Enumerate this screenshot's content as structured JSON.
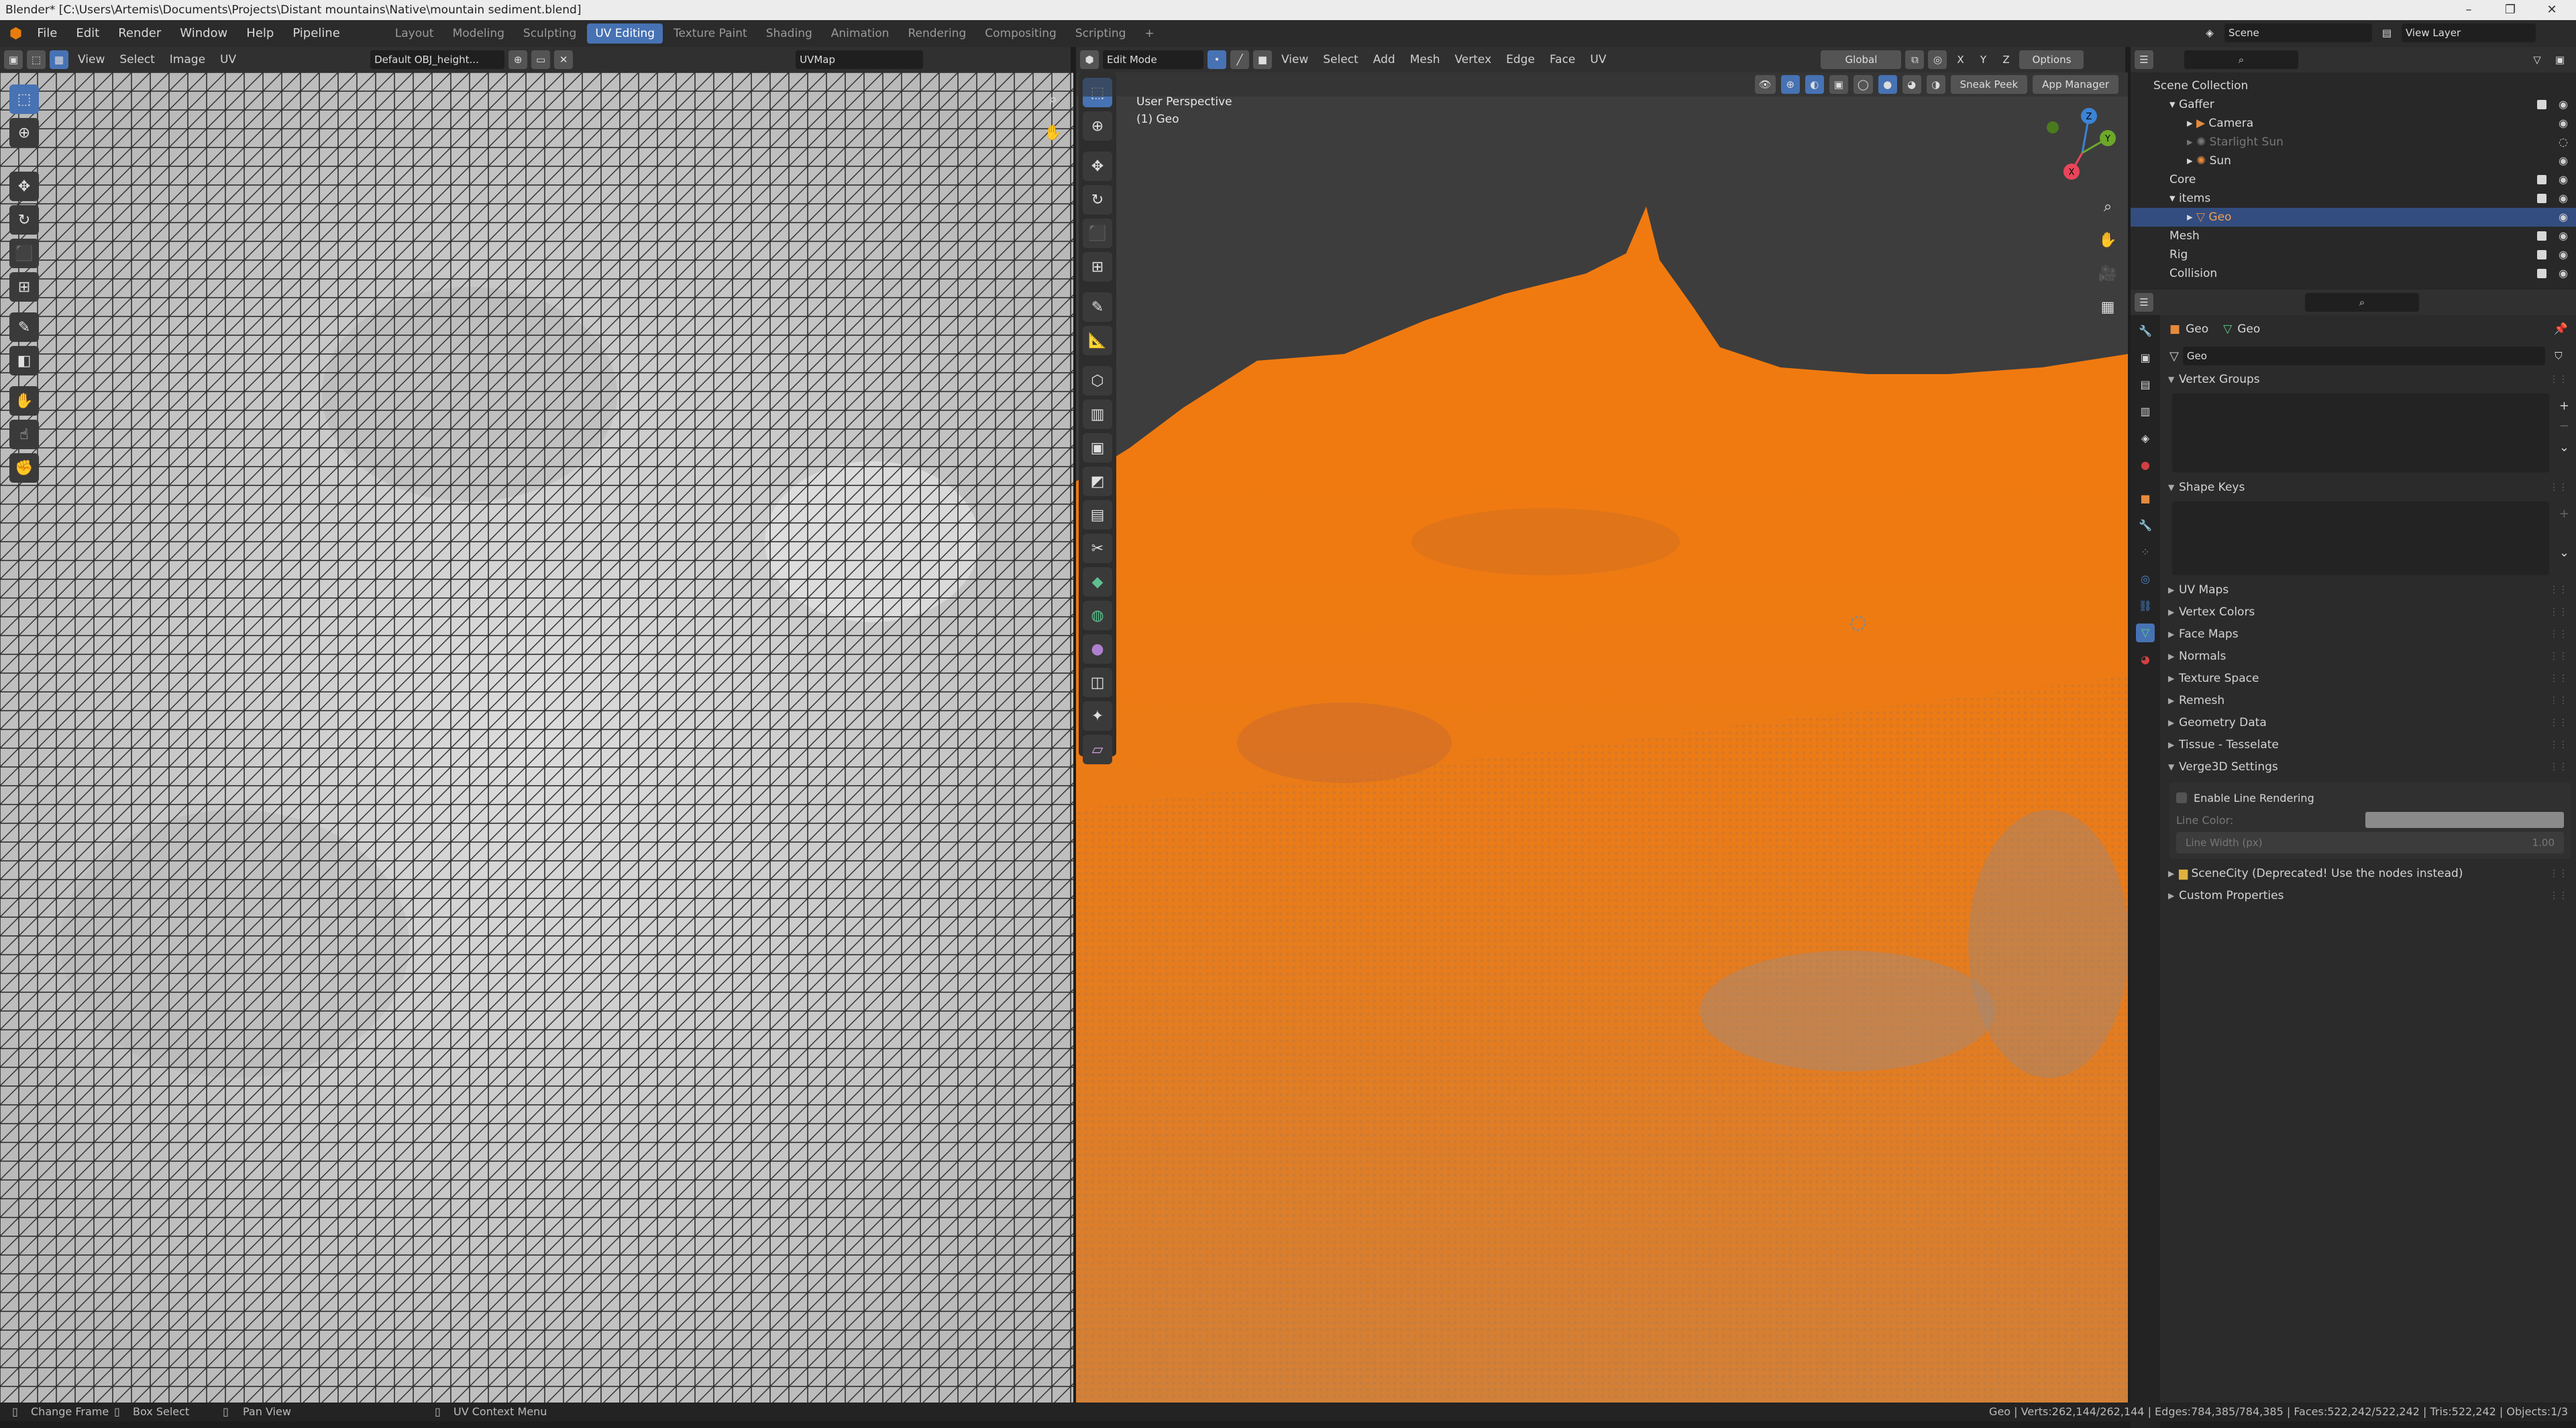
{
  "window": {
    "title": "Blender* [C:\\Users\\Artemis\\Documents\\Projects\\Distant mountains\\Native\\mountain sediment.blend]",
    "controls": [
      "–",
      "❐",
      "✕"
    ]
  },
  "menubar": {
    "menus": [
      "File",
      "Edit",
      "Render",
      "Window",
      "Help",
      "Pipeline"
    ],
    "workspaces": [
      "Layout",
      "Modeling",
      "Sculpting",
      "UV Editing",
      "Texture Paint",
      "Shading",
      "Animation",
      "Rendering",
      "Compositing",
      "Scripting"
    ],
    "active_workspace": "UV Editing",
    "add_workspace": "+",
    "scene": "Scene",
    "view_layer": "View Layer"
  },
  "uv_editor": {
    "menus": [
      "View",
      "Select",
      "Image",
      "UV"
    ],
    "image_name": "Default OBJ_height...",
    "uvmap": "UVMap",
    "tools": [
      "select-box",
      "cursor",
      "move",
      "rotate",
      "scale",
      "transform",
      "annotate",
      "rip",
      "grab",
      "relax",
      "pinch"
    ]
  },
  "viewport": {
    "mode": "Edit Mode",
    "menus": [
      "View",
      "Select",
      "Add",
      "Mesh",
      "Vertex",
      "Edge",
      "Face",
      "UV"
    ],
    "orientation": "Global",
    "axes": [
      "X",
      "Y",
      "Z"
    ],
    "options_label": "Options",
    "overlay_title": "User Perspective",
    "overlay_sub": "(1) Geo",
    "sneak_peek": "Sneak Peek",
    "app_manager": "App Manager",
    "gizmo": {
      "x": "X",
      "y": "Y",
      "z": "Z"
    },
    "colors": {
      "mesh_selected": "#f07a10",
      "background": "#3d3d3d",
      "x_axis": "#e8455a",
      "y_axis": "#6da82a",
      "z_axis": "#3b83d6"
    }
  },
  "outliner": {
    "title": "Scene Collection",
    "rows": [
      {
        "label": "Gaffer",
        "indent": 1,
        "icon": "collection"
      },
      {
        "label": "Camera",
        "indent": 2,
        "icon": "camera"
      },
      {
        "label": "Starlight Sun",
        "indent": 2,
        "icon": "light"
      },
      {
        "label": "Sun",
        "indent": 2,
        "icon": "light"
      },
      {
        "label": "Core",
        "indent": 1,
        "icon": "collection"
      },
      {
        "label": "items",
        "indent": 1,
        "icon": "collection"
      },
      {
        "label": "Geo",
        "indent": 2,
        "icon": "mesh",
        "selected": true
      },
      {
        "label": "Mesh",
        "indent": 1,
        "icon": "collection"
      },
      {
        "label": "Rig",
        "indent": 1,
        "icon": "collection"
      },
      {
        "label": "Collision",
        "indent": 1,
        "icon": "collection"
      }
    ]
  },
  "properties": {
    "breadcrumb_object": "Geo",
    "breadcrumb_data": "Geo",
    "data_name": "Geo",
    "open_panels": [
      "Vertex Groups",
      "Shape Keys"
    ],
    "panels": [
      "UV Maps",
      "Vertex Colors",
      "Face Maps",
      "Normals",
      "Texture Space",
      "Remesh",
      "Geometry Data",
      "Tissue - Tesselate"
    ],
    "verge3d": {
      "title": "Verge3D Settings",
      "enable_label": "Enable Line Rendering",
      "line_color_label": "Line Color:",
      "line_width_label": "Line Width (px)",
      "line_width_value": "1.00"
    },
    "extra_panels": [
      "SceneCity (Deprecated! Use the nodes instead)",
      "Custom Properties"
    ]
  },
  "statusbar": {
    "left": [
      "Change Frame",
      "Box Select",
      "Pan View",
      "UV Context Menu"
    ],
    "stats": "Geo | Verts:262,144/262,144 | Edges:784,385/784,385 | Faces:522,242/522,242 | Tris:522,242 | Objects:1/3"
  }
}
